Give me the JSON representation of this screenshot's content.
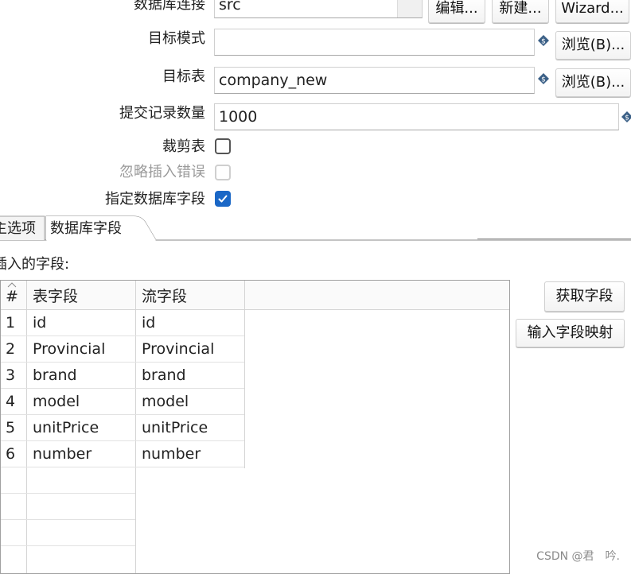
{
  "form": {
    "connection": {
      "label": "数据库连接",
      "value": "src",
      "edit_button": "编辑...",
      "new_button": "新建...",
      "wizard_button": "Wizard..."
    },
    "target_schema": {
      "label": "目标模式",
      "value": "",
      "browse_button": "浏览(B)..."
    },
    "target_table": {
      "label": "目标表",
      "value": "company_new",
      "browse_button": "浏览(B)..."
    },
    "commit_size": {
      "label": "提交记录数量",
      "value": "1000"
    },
    "truncate": {
      "label": "裁剪表",
      "checked": false
    },
    "ignore_errors": {
      "label": "忽略插入错误",
      "checked": false,
      "disabled": true
    },
    "specify_fields": {
      "label": "指定数据库字段",
      "checked": true
    }
  },
  "tabs": [
    {
      "label": "主选项"
    },
    {
      "label": "数据库字段",
      "active": true
    }
  ],
  "fields_section": {
    "title": "插入的字段:",
    "columns": [
      "#",
      "表字段",
      "流字段"
    ],
    "rows": [
      [
        "1",
        "id",
        "id"
      ],
      [
        "2",
        "Provincial",
        "Provincial"
      ],
      [
        "3",
        "brand",
        "brand"
      ],
      [
        "4",
        "model",
        "model"
      ],
      [
        "5",
        "unitPrice",
        "unitPrice"
      ],
      [
        "6",
        "number",
        "number"
      ]
    ],
    "get_fields_button": "获取字段",
    "mapping_button": "输入字段映射"
  },
  "watermark": "CSDN @君　吟."
}
